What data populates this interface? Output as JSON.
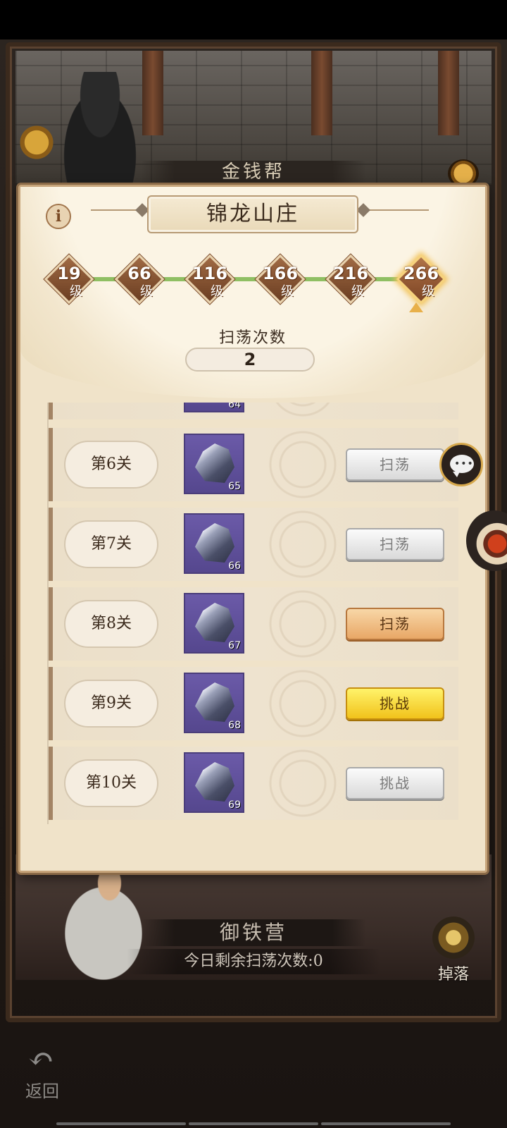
{
  "background": {
    "top_banner": "金钱帮",
    "bottom_banner": "御铁营",
    "remaining_sweeps": "今日剩余扫荡次数:0",
    "drop_label": "掉落",
    "back_label": "返回"
  },
  "dialog": {
    "title": "锦龙山庄",
    "info_icon": "i",
    "level_suffix": "级",
    "levels": [
      "19",
      "66",
      "116",
      "166",
      "216",
      "266"
    ],
    "active_level": "266",
    "sweep_title": "扫荡次数",
    "sweep_count": "2"
  },
  "stages": [
    {
      "label": "",
      "reward_count": "64",
      "button": "",
      "style": "gray"
    },
    {
      "label": "第6关",
      "reward_count": "65",
      "button": "扫荡",
      "style": "gray"
    },
    {
      "label": "第7关",
      "reward_count": "66",
      "button": "扫荡",
      "style": "gray"
    },
    {
      "label": "第8关",
      "reward_count": "67",
      "button": "扫荡",
      "style": "orange"
    },
    {
      "label": "第9关",
      "reward_count": "68",
      "button": "挑战",
      "style": "gold"
    },
    {
      "label": "第10关",
      "reward_count": "69",
      "button": "挑战",
      "style": "gray"
    }
  ],
  "colors": {
    "dialog_bg": "#f0e3c9",
    "track_green": "#8fbf63",
    "reward_purple": "#6b5aa8",
    "btn_gold": "#f1c21b",
    "btn_orange": "#e8a766"
  },
  "icons": [
    "info-icon",
    "chat-icon",
    "back-arrow-icon",
    "drop-star-icon",
    "ore-icon",
    "coin-icon"
  ]
}
